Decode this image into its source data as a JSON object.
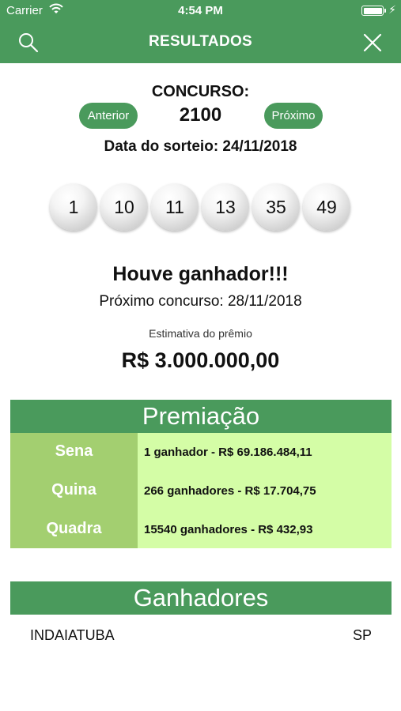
{
  "status_bar": {
    "carrier": "Carrier",
    "time": "4:54 PM",
    "battery_level": 1.0
  },
  "nav": {
    "title": "RESULTADOS",
    "left_icon": "search-icon",
    "right_icon": "close-icon"
  },
  "concurso": {
    "label": "CONCURSO:",
    "number": "2100",
    "prev_label": "Anterior",
    "next_label": "Próximo",
    "draw_date": "Data do sorteio: 24/11/2018"
  },
  "numbers": [
    "1",
    "10",
    "11",
    "13",
    "35",
    "49"
  ],
  "result": {
    "winner_text": "Houve ganhador!!!",
    "next_draw": "Próximo concurso: 28/11/2018",
    "estimate_label": "Estimativa do prêmio",
    "estimate_value": "R$ 3.000.000,00"
  },
  "premiacao": {
    "title": "Premiação",
    "rows": [
      {
        "label": "Sena",
        "value": "1 ganhador - R$ 69.186.484,11"
      },
      {
        "label": "Quina",
        "value": "266 ganhadores - R$ 17.704,75"
      },
      {
        "label": "Quadra",
        "value": "15540 ganhadores - R$ 432,93"
      }
    ]
  },
  "ganhadores": {
    "title": "Ganhadores",
    "rows": [
      {
        "city": "INDAIATUBA",
        "state": "SP"
      }
    ]
  },
  "colors": {
    "primary_green": "#4a9a5c",
    "label_green": "#a3cf70",
    "value_green": "#d4fda6"
  }
}
